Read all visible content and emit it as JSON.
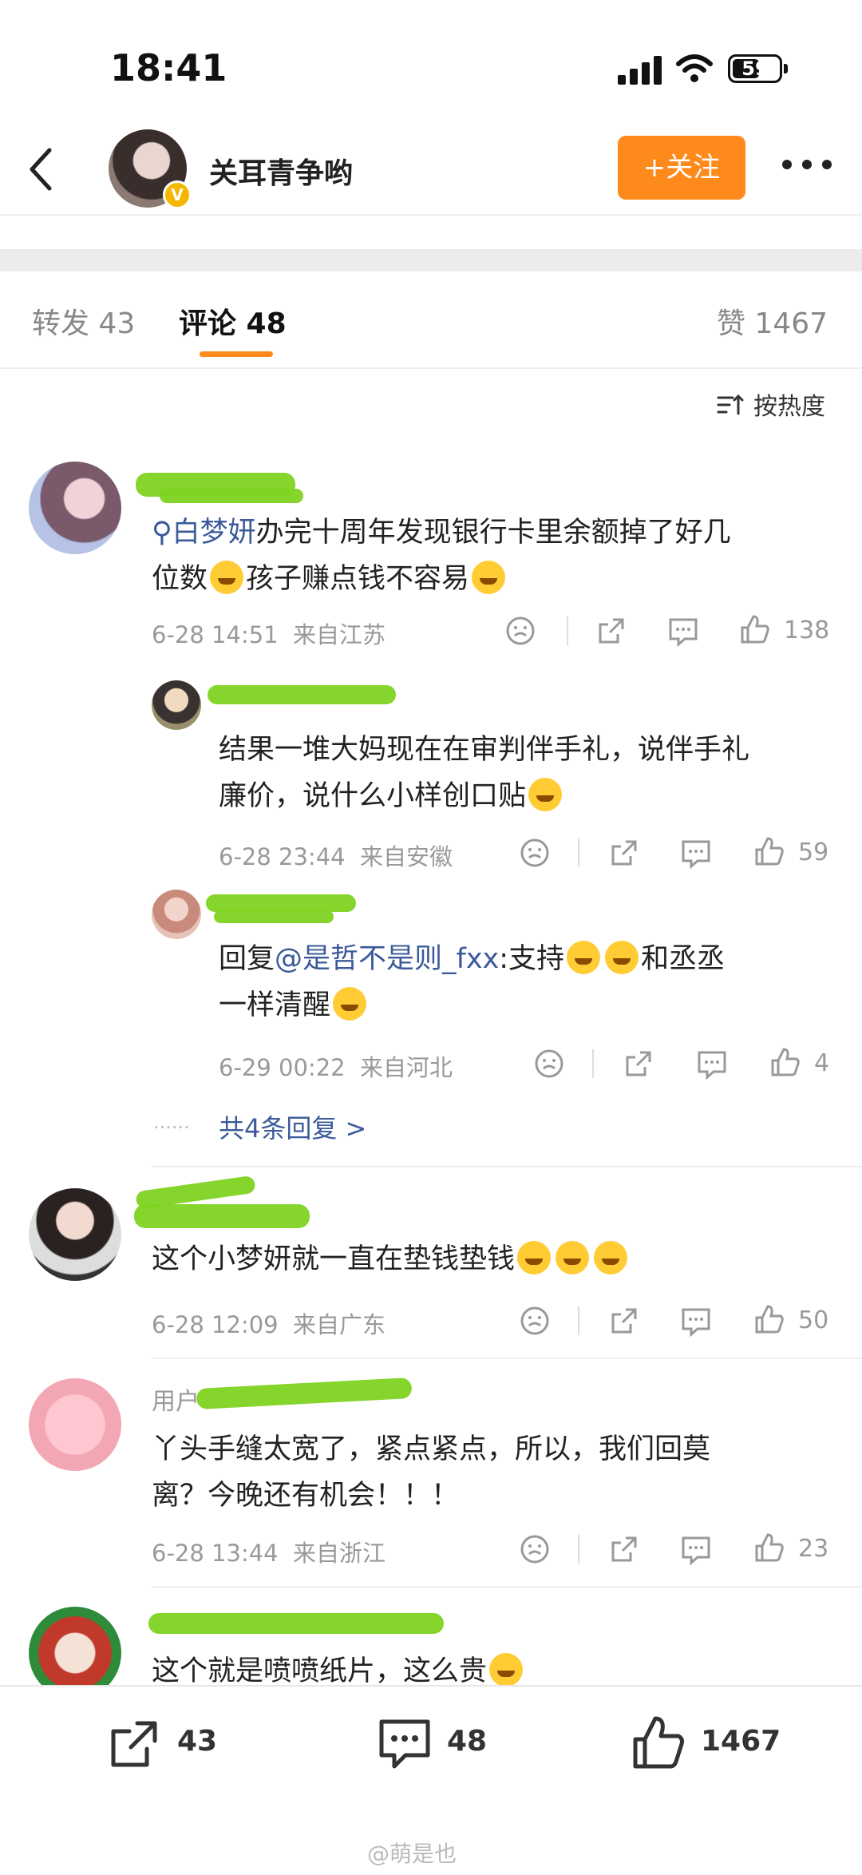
{
  "status_bar": {
    "time": "18:41",
    "battery": "59"
  },
  "header": {
    "user_name": "关耳青争哟",
    "follow_label": "+关注"
  },
  "tabs": {
    "repost": "转发 43",
    "comment": "评论 48",
    "like": "赞 1467"
  },
  "sort_label": "按热度",
  "comments": [
    {
      "text_pre": "白梦妍",
      "text_line1": "办完十周年发现银行卡里余额掉了好几",
      "text_line2a": "位数",
      "text_line2b": "孩子赚点钱不容易",
      "time": "6-28 14:51",
      "loc": "来自江苏",
      "likes": "138"
    },
    {
      "text_line1": "结果一堆大妈现在在审判伴手礼，说伴手礼",
      "text_line2": "廉价，说什么小样创口贴",
      "time": "6-28 23:44",
      "loc": "来自安徽",
      "likes": "59"
    },
    {
      "reply_prefix": "回复",
      "mention": "@是哲不是则_fxx",
      "text_line1": ":支持",
      "text_line1b": "和丞丞",
      "text_line2": "一样清醒",
      "time": "6-29 00:22",
      "loc": "来自河北",
      "likes": "4"
    },
    {
      "more_replies": "共4条回复 >"
    },
    {
      "text_line1": "这个小梦妍就一直在垫钱垫钱",
      "time": "6-28 12:09",
      "loc": "来自广东",
      "likes": "50"
    },
    {
      "name_fragment": "用户",
      "text_line1": "丫头手缝太宽了，紧点紧点，所以，我们回莫",
      "text_line2": "离？今晚还有机会！！！",
      "time": "6-28 13:44",
      "loc": "来自浙江",
      "likes": "23"
    },
    {
      "text_line1": "这个就是喷喷纸片，这么贵"
    }
  ],
  "bottom_bar": {
    "repost": "43",
    "comment": "48",
    "like": "1467"
  },
  "watermark": "@萌是也",
  "colors": {
    "accent": "#ff8a1c",
    "link": "#3b5a9a",
    "scribble": "#7ed321"
  }
}
